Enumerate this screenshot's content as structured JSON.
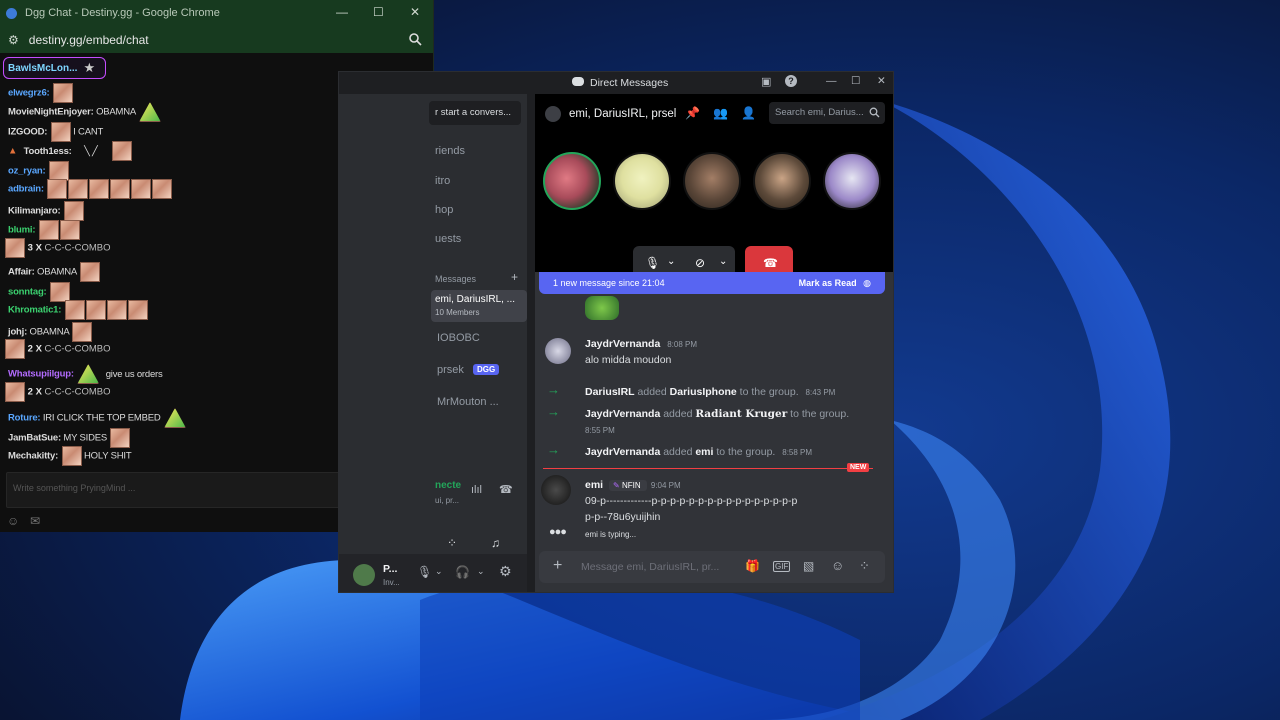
{
  "chrome": {
    "title": "Dgg Chat - Destiny.gg - Google Chrome",
    "url": "destiny.gg/embed/chat",
    "pinned_user": "BawlsMcLon...",
    "input_placeholder": "Write something PryingMind ...",
    "chat_lines": [
      {
        "user": "elwegrz6:",
        "color": "#5aa7ff",
        "text": ""
      },
      {
        "user": "MovieNightEnjoyer:",
        "color": "#dcdcdc",
        "text": "OBAMNA"
      },
      {
        "user": "IZGOOD:",
        "color": "#dcdcdc",
        "text": "I CANT"
      },
      {
        "user": "Tooth1ess:",
        "color": "#dcdcdc",
        "text": ""
      },
      {
        "user": "oz_ryan:",
        "color": "#5aa7ff",
        "text": ""
      },
      {
        "user": "adbrain:",
        "color": "#5aa7ff",
        "text": ""
      },
      {
        "user": "Kilimanjaro:",
        "color": "#dcdcdc",
        "text": ""
      },
      {
        "user": "blumi:",
        "color": "#3bd16f",
        "text": ""
      },
      {
        "user": "Affair:",
        "color": "#dcdcdc",
        "text": "OBAMNA"
      },
      {
        "user": "sonntag:",
        "color": "#3bd16f",
        "text": ""
      },
      {
        "user": "Khromatic1:",
        "color": "#3bd16f",
        "text": ""
      },
      {
        "user": "johj:",
        "color": "#dcdcdc",
        "text": "OBAMNA"
      },
      {
        "user": "Whatsupiilgup:",
        "color": "#b36cff",
        "text": "give us orders"
      },
      {
        "user": "Roture:",
        "color": "#5aa7ff",
        "text": "IRI CLICK THE TOP EMBED"
      },
      {
        "user": "JamBatSue:",
        "color": "#dcdcdc",
        "text": "MY SIDES"
      },
      {
        "user": "Mechakitty:",
        "color": "#dcdcdc",
        "text": "HOLY SHIT"
      }
    ],
    "combos": [
      {
        "count": "3 X",
        "label": "C-C-C-COMBO"
      },
      {
        "count": "2 X",
        "label": "C-C-C-COMBO"
      },
      {
        "count": "2 X",
        "label": "C-C-C-COMBO"
      }
    ]
  },
  "discord": {
    "title": "Direct Messages",
    "start_conversation": "r start a convers...",
    "sidebar_items": [
      "riends",
      "itro",
      "hop",
      "uests"
    ],
    "dm_section": "Messages",
    "dm_items": [
      {
        "name": "emi, DariusIRL, ...",
        "sub": "10 Members"
      },
      {
        "name": "IOBOBC",
        "sub": ""
      },
      {
        "name": "prsek",
        "sub": "",
        "badge": "DGG"
      },
      {
        "name": "MrMouton ...",
        "sub": ""
      }
    ],
    "voice_status": "necte",
    "voice_sub": "ui, pr...",
    "user_name": "P...",
    "user_status": "Inv...",
    "header_channel": "emi, DariusIRL, prsel",
    "search_placeholder": "Search emi, Darius...",
    "new_message_banner": "1 new message since 21:04",
    "mark_as_read": "Mark as Read",
    "messages": [
      {
        "author": "JaydrVernanda",
        "time": "8:08 PM",
        "text": "alo midda moudon"
      }
    ],
    "system_messages": [
      {
        "actor": "DariusIRL",
        "verb": "added",
        "target": "DariusIphone",
        "tail": "to the group.",
        "time": "8:43 PM"
      },
      {
        "actor": "JaydrVernanda",
        "verb": "added",
        "target": "Radiant Kruger",
        "tail": "to the group.",
        "time": "8:55 PM"
      },
      {
        "actor": "JaydrVernanda",
        "verb": "added",
        "target": "emi",
        "tail": "to the group.",
        "time": "8:58 PM"
      }
    ],
    "new_badge": "NEW",
    "last_message": {
      "author": "emi",
      "tag": "NFIN",
      "time": "9:04 PM",
      "line1": "09-p-------------p-p-p-p-p-p-p-p-p-p-p-p-p-p-p-p",
      "line2": "p-p--78u6yuijhin"
    },
    "typing": "emi is typing...",
    "composer_placeholder": "Message emi, DariusIRL, pr..."
  }
}
